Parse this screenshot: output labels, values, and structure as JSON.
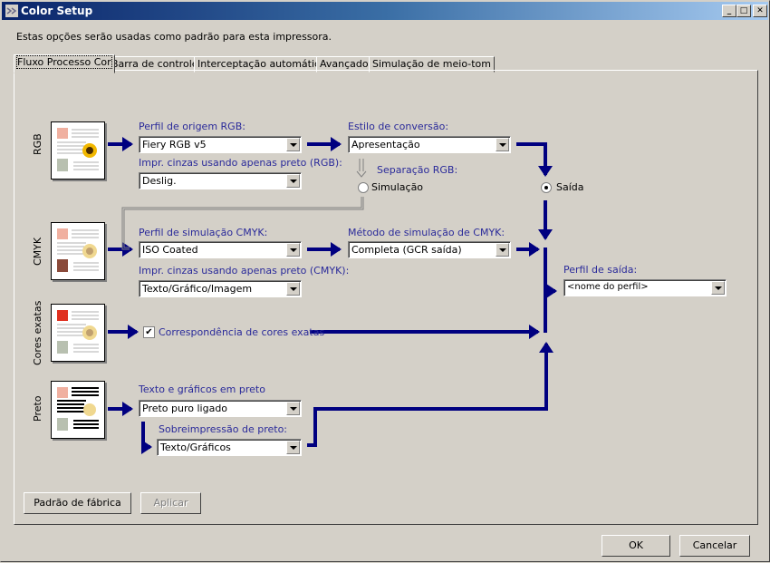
{
  "window": {
    "title": "Color Setup",
    "controls": {
      "minimize": "_",
      "maximize": "□",
      "close": "✕"
    }
  },
  "intro_text": "Estas opções serão usadas como padrão para esta impressora.",
  "tabs": [
    {
      "label": "Fluxo Processo Cor",
      "active": true
    },
    {
      "label": "Barra de controle",
      "active": false
    },
    {
      "label": "Interceptação automática",
      "active": false
    },
    {
      "label": "Avançado",
      "active": false
    },
    {
      "label": "Simulação de meio-tom",
      "active": false
    }
  ],
  "rows": {
    "rgb": {
      "label": "RGB",
      "source_profile": {
        "label": "Perfil de origem RGB:",
        "value": "Fiery RGB v5"
      },
      "gray_black_only": {
        "label": "Impr. cinzas usando apenas preto (RGB):",
        "value": "Deslig."
      },
      "rendering_style": {
        "label": "Estilo de conversão:",
        "value": "Apresentação"
      },
      "rgb_separation": {
        "label": "Separação RGB:",
        "option_simulation": "Simulação",
        "option_output": "Saída",
        "selected": "Saída"
      }
    },
    "cmyk": {
      "label": "CMYK",
      "simulation_profile": {
        "label": "Perfil de simulação CMYK:",
        "value": "ISO Coated"
      },
      "gray_black_only": {
        "label": "Impr. cinzas usando apenas preto (CMYK):",
        "value": "Texto/Gráfico/Imagem"
      },
      "simulation_method": {
        "label": "Método de simulação de CMYK:",
        "value": "Completa (GCR saída)"
      }
    },
    "spot": {
      "label": "Cores exatas",
      "spot_matching": {
        "label": "Correspondência de cores exatas",
        "checked": true
      }
    },
    "black": {
      "label": "Preto",
      "black_text_graphics": {
        "label": "Texto e gráficos em preto",
        "value": "Preto puro ligado"
      },
      "black_overprint": {
        "label": "Sobreimpressão de preto:",
        "value": "Texto/Gráficos"
      }
    }
  },
  "output_profile": {
    "label": "Perfil de saída:",
    "value": "<nome do perfil>"
  },
  "buttons": {
    "factory_default": "Padrão de fábrica",
    "apply": "Aplicar",
    "ok": "OK",
    "cancel": "Cancelar"
  },
  "colors": {
    "flow_arrow": "#000080",
    "label_blue": "#2a2a9a",
    "dialog_bg": "#d4d0c8"
  }
}
